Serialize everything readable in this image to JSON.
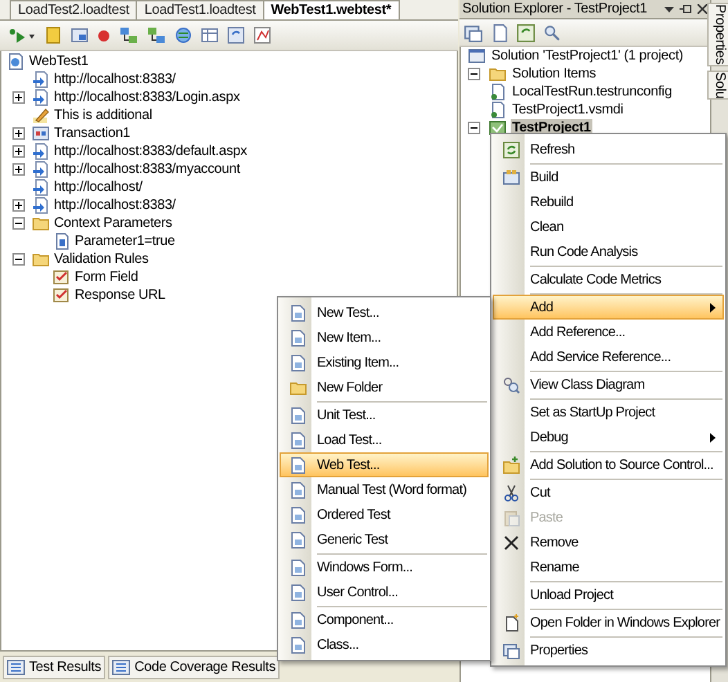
{
  "editor": {
    "tabs": [
      {
        "label": "LoadTest2.loadtest",
        "selected": false
      },
      {
        "label": "LoadTest1.loadtest",
        "selected": false
      },
      {
        "label": "WebTest1.webtest*",
        "selected": true
      }
    ],
    "tree": [
      {
        "label": "WebTest1",
        "kind": "webtest",
        "children": [
          {
            "label": "http://localhost:8383/",
            "kind": "request"
          },
          {
            "label": "http://localhost:8383/Login.aspx",
            "kind": "request",
            "expanded": false
          },
          {
            "label": "This is additional",
            "kind": "comment"
          },
          {
            "label": "Transaction1",
            "kind": "transaction",
            "expanded": false
          },
          {
            "label": "http://localhost:8383/default.aspx",
            "kind": "request",
            "expanded": false
          },
          {
            "label": "http://localhost:8383/myaccount",
            "kind": "request",
            "expanded": false
          },
          {
            "label": "http://localhost/",
            "kind": "request"
          },
          {
            "label": "http://localhost:8383/",
            "kind": "request",
            "expanded": false
          },
          {
            "label": "Context Parameters",
            "kind": "folder",
            "expanded": true,
            "children": [
              {
                "label": "Parameter1=true",
                "kind": "parameter"
              }
            ]
          },
          {
            "label": "Validation Rules",
            "kind": "folder",
            "expanded": true,
            "children": [
              {
                "label": "Form Field",
                "kind": "rule"
              },
              {
                "label": "Response URL",
                "kind": "rule"
              }
            ]
          }
        ]
      }
    ]
  },
  "bottom_tabs": [
    "Test Results",
    "Code Coverage Results"
  ],
  "solution_explorer": {
    "title": "Solution Explorer - TestProject1",
    "tree": [
      {
        "label": "Solution 'TestProject1' (1 project)",
        "kind": "solution",
        "selected": false
      },
      {
        "label": "Solution Items",
        "kind": "folder",
        "expanded": true,
        "selected": false,
        "children": [
          {
            "label": "LocalTestRun.testrunconfig",
            "kind": "file",
            "selected": false
          },
          {
            "label": "TestProject1.vsmdi",
            "kind": "file",
            "selected": false
          }
        ]
      },
      {
        "label": "TestProject1",
        "kind": "project",
        "expanded": true,
        "selected": true
      }
    ]
  },
  "side_tabs": [
    "Properties",
    "Solu"
  ],
  "context_menu": {
    "groups": [
      [
        {
          "label": "Refresh",
          "selected": false,
          "disabled": false,
          "submenu": false
        }
      ],
      [
        {
          "label": "Build",
          "selected": false,
          "disabled": false,
          "submenu": false
        },
        {
          "label": "Rebuild",
          "selected": false,
          "disabled": false,
          "submenu": false
        },
        {
          "label": "Clean",
          "selected": false,
          "disabled": false,
          "submenu": false
        },
        {
          "label": "Run Code Analysis",
          "selected": false,
          "disabled": false,
          "submenu": false
        }
      ],
      [
        {
          "label": "Calculate Code Metrics",
          "selected": false,
          "disabled": false,
          "submenu": false
        }
      ],
      [
        {
          "label": "Add",
          "selected": true,
          "disabled": false,
          "submenu": true
        },
        {
          "label": "Add Reference...",
          "selected": false,
          "disabled": false,
          "submenu": false
        },
        {
          "label": "Add Service Reference...",
          "selected": false,
          "disabled": false,
          "submenu": false
        }
      ],
      [
        {
          "label": "View Class Diagram",
          "selected": false,
          "disabled": false,
          "submenu": false
        }
      ],
      [
        {
          "label": "Set as StartUp Project",
          "selected": false,
          "disabled": false,
          "submenu": false
        },
        {
          "label": "Debug",
          "selected": false,
          "disabled": false,
          "submenu": true
        }
      ],
      [
        {
          "label": "Add Solution to Source Control...",
          "selected": false,
          "disabled": false,
          "submenu": false
        }
      ],
      [
        {
          "label": "Cut",
          "selected": false,
          "disabled": false,
          "submenu": false
        },
        {
          "label": "Paste",
          "selected": false,
          "disabled": true,
          "submenu": false
        },
        {
          "label": "Remove",
          "selected": false,
          "disabled": false,
          "submenu": false
        },
        {
          "label": "Rename",
          "selected": false,
          "disabled": false,
          "submenu": false
        }
      ],
      [
        {
          "label": "Unload Project",
          "selected": false,
          "disabled": false,
          "submenu": false
        }
      ],
      [
        {
          "label": "Open Folder in Windows Explorer",
          "selected": false,
          "disabled": false,
          "submenu": false
        }
      ],
      [
        {
          "label": "Properties",
          "selected": false,
          "disabled": false,
          "submenu": false
        }
      ]
    ]
  },
  "add_submenu": {
    "groups": [
      [
        {
          "label": "New Test...",
          "selected": false
        },
        {
          "label": "New Item...",
          "selected": false
        },
        {
          "label": "Existing Item...",
          "selected": false
        },
        {
          "label": "New Folder",
          "selected": false
        }
      ],
      [
        {
          "label": "Unit Test...",
          "selected": false
        },
        {
          "label": "Load Test...",
          "selected": false
        },
        {
          "label": "Web Test...",
          "selected": true
        },
        {
          "label": "Manual Test (Word format)",
          "selected": false
        },
        {
          "label": "Ordered Test",
          "selected": false
        },
        {
          "label": "Generic Test",
          "selected": false
        }
      ],
      [
        {
          "label": "Windows Form...",
          "selected": false
        },
        {
          "label": "User Control...",
          "selected": false
        }
      ],
      [
        {
          "label": "Component...",
          "selected": false
        },
        {
          "label": "Class...",
          "selected": false
        }
      ]
    ]
  }
}
